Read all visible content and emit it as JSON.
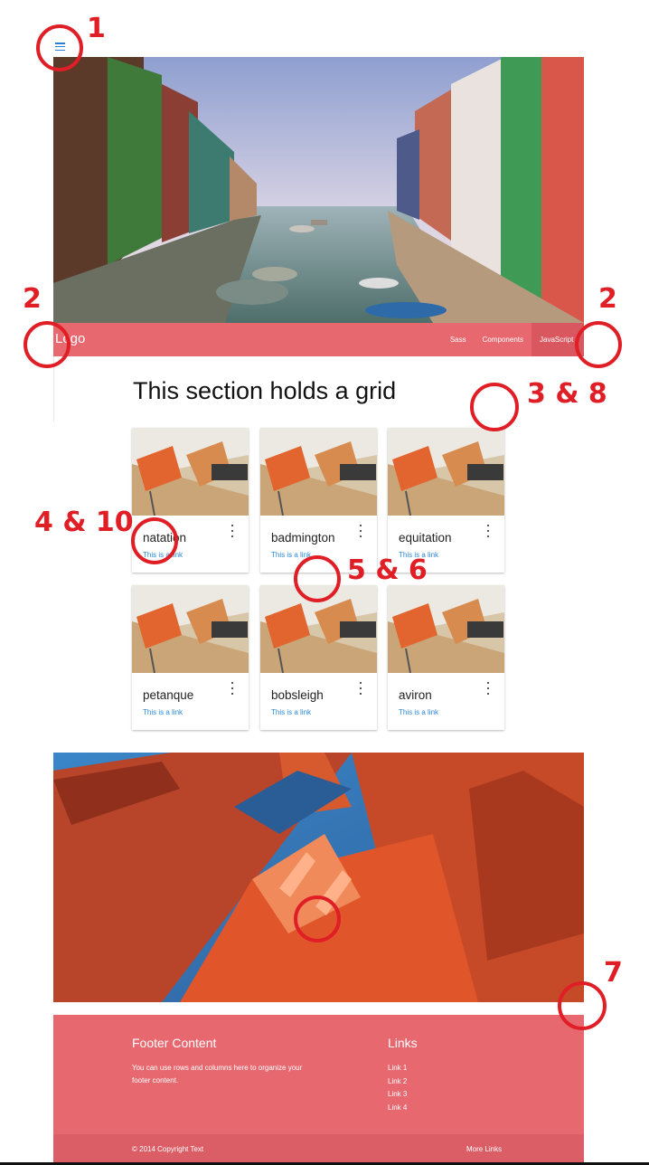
{
  "colors": {
    "primary": "#e8686f",
    "primary_dark": "#d9575f",
    "link": "#2a88d8",
    "annotation": "#e01e26"
  },
  "icons": {
    "menu": "hamburger-icon",
    "card_more": "more-vert-icon"
  },
  "navbar": {
    "logo": "Logo",
    "links": [
      "Sass",
      "Components",
      "JavaScript"
    ]
  },
  "section": {
    "title": "This section holds a grid"
  },
  "cards": [
    {
      "title": "natation",
      "link": "This is a link"
    },
    {
      "title": "badmington",
      "link": "This is a link"
    },
    {
      "title": "equitation",
      "link": "This is a link"
    },
    {
      "title": "petanque",
      "link": "This is a link"
    },
    {
      "title": "bobsleigh",
      "link": "This is a link"
    },
    {
      "title": "aviron",
      "link": "This is a link"
    }
  ],
  "footer": {
    "title": "Footer Content",
    "text": "You can use rows and columns here to organize your footer content.",
    "links_title": "Links",
    "links": [
      "Link 1",
      "Link 2",
      "Link 3",
      "Link 4"
    ],
    "copyright": "© 2014 Copyright Text",
    "more_links": "More Links"
  },
  "annotations": [
    "1",
    "2",
    "2",
    "3 & 8",
    "4 & 10",
    "5 & 6",
    "7"
  ]
}
